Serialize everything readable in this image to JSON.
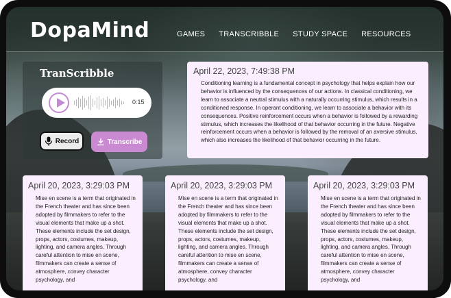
{
  "app": {
    "logo": "DopaMind"
  },
  "nav": {
    "items": [
      "GAMES",
      "TRANSCRIBBLE",
      "STUDY SPACE",
      "RESOURCES"
    ]
  },
  "recorder": {
    "title": "TranScribble",
    "duration": "0:15",
    "record_label": "Record",
    "transcribe_label": "Transcribe",
    "accent_color": "#c98ad2"
  },
  "transcripts": {
    "featured": {
      "date": "April 22, 2023, 7:49:38 PM",
      "text": "Conditioning learning is a fundamental concept in psychology that helps explain how our behavior is influenced by the consequences of our actions. In classical conditioning, we learn to associate a neutral stimulus with a naturally occurring stimulus, which results in a conditioned response. In operant conditioning, we learn to associate a behavior with its consequences. Positive reinforcement occurs when a behavior is followed by a rewarding stimulus, which increases the likelihood of that behavior occurring in the future. Negative reinforcement occurs when a behavior is followed by the removal of an aversive stimulus, which also increases the likelihood of that behavior occurring in the future."
    },
    "cards": [
      {
        "date": "April 20, 2023, 3:29:03 PM",
        "text": "Mise en scene is a term that originated in the French theater and has since been adopted by filmmakers to refer to the visual elements that make up a shot. These elements include the set design, props, actors, costumes, makeup, lighting, and camera angles. Through careful attention to mise en scene, filmmakers can create a sense of atmosphere, convey character psychology, and"
      },
      {
        "date": "April 20, 2023, 3:29:03 PM",
        "text": "Mise en scene is a term that originated in the French theater and has since been adopted by filmmakers to refer to the visual elements that make up a shot. These elements include the set design, props, actors, costumes, makeup, lighting, and camera angles. Through careful attention to mise en scene, filmmakers can create a sense of atmosphere, convey character psychology, and"
      },
      {
        "date": "April 20, 2023, 3:29:03 PM",
        "text": "Mise en scene is a term that originated in the French theater and has since been adopted by filmmakers to refer to the visual elements that make up a shot. These elements include the set design, props, actors, costumes, makeup, lighting, and camera angles. Through careful attention to mise en scene, filmmakers can create a sense of atmosphere, convey character psychology, and"
      }
    ]
  },
  "icons": {
    "play": "play-icon",
    "waveform": "waveform-icon",
    "microphone": "microphone-icon",
    "download": "download-icon"
  }
}
